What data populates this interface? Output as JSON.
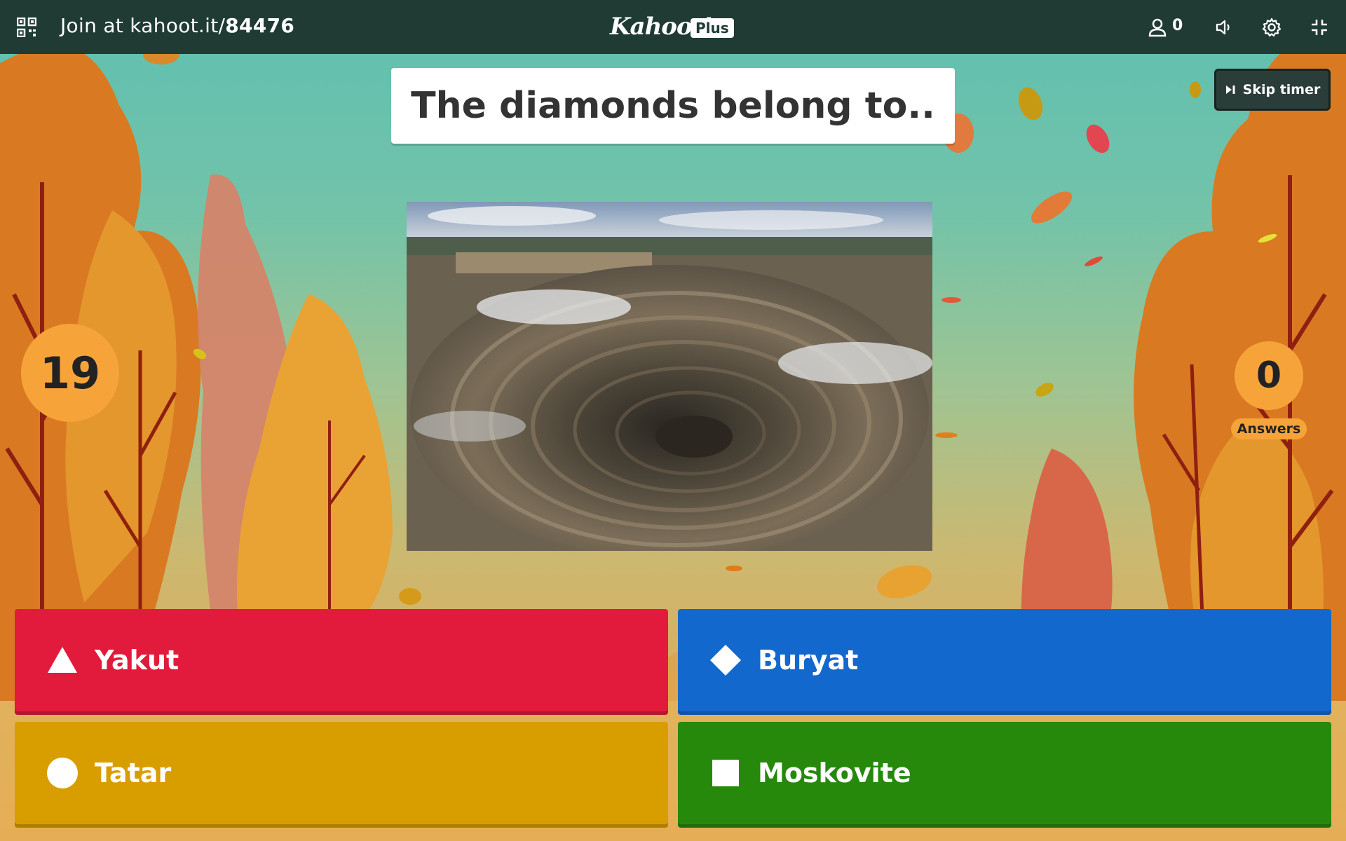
{
  "topbar": {
    "join_prefix": "Join at kahoot.it/",
    "pin": "84476",
    "logo_text": "Kahoot!",
    "plan_badge": "Plus",
    "player_count": "0",
    "icons": [
      "qr-code-icon",
      "user-icon",
      "volume-icon",
      "gear-icon",
      "exit-fullscreen-icon"
    ]
  },
  "question": {
    "title": "The diamonds belong to..",
    "media_description_icon": "open-pit-diamond-mine-photo"
  },
  "controls": {
    "skip_timer_label": "Skip timer"
  },
  "timer": {
    "seconds_left": "19"
  },
  "answers_panel": {
    "count": "0",
    "label": "Answers"
  },
  "choices": [
    {
      "label": "Yakut",
      "shape": "triangle-icon",
      "color": "#e21b3c"
    },
    {
      "label": "Buryat",
      "shape": "diamond-icon",
      "color": "#1368ce"
    },
    {
      "label": "Tatar",
      "shape": "circle-icon",
      "color": "#d89e00"
    },
    {
      "label": "Moskovite",
      "shape": "square-icon",
      "color": "#26890c"
    }
  ],
  "colors": {
    "topbar": "#1f3b34",
    "accent_orange": "#f6a43a"
  }
}
